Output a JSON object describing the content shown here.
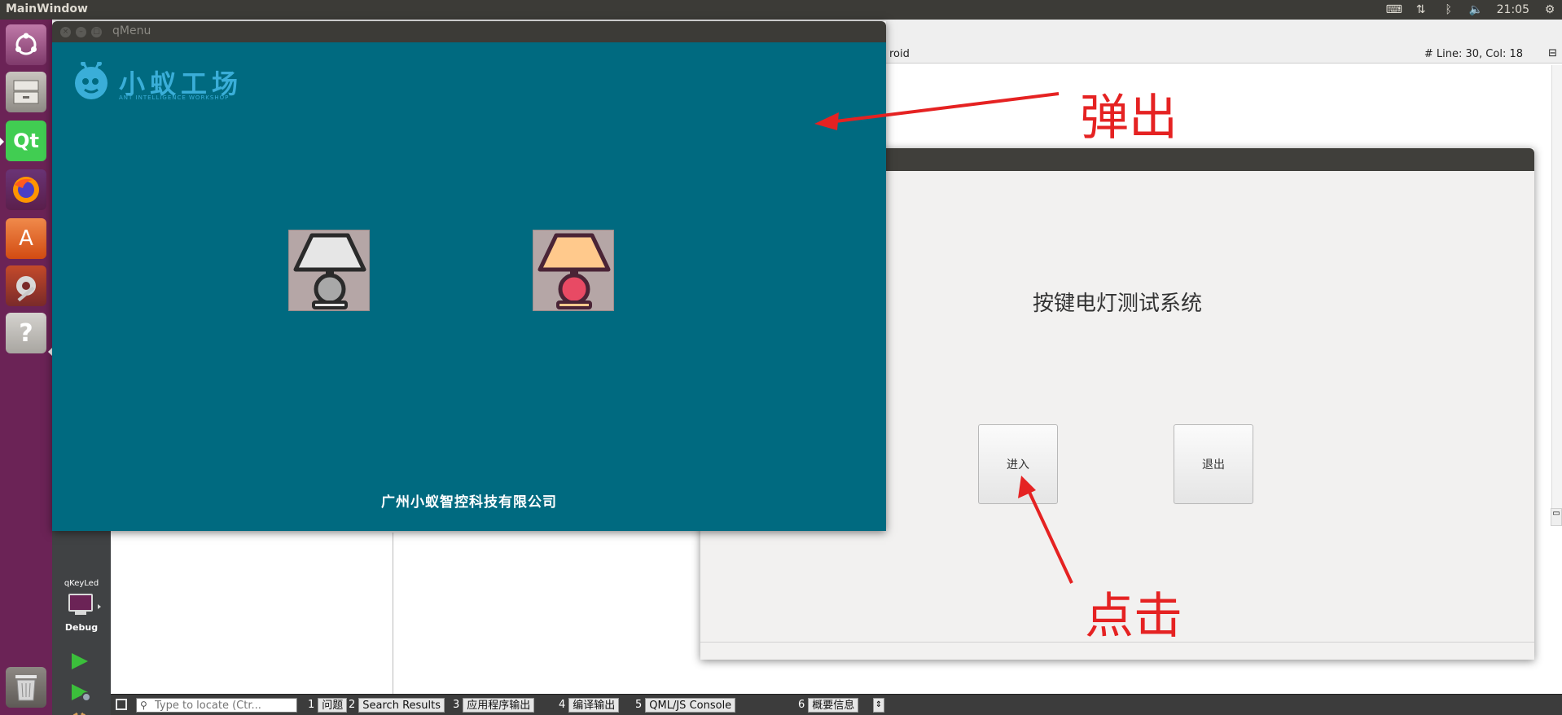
{
  "top_panel": {
    "title": "MainWindow",
    "tray": {
      "keyboard_icon": "keyboard-icon",
      "network_icon": "network-arrows-icon",
      "bluetooth_icon": "bluetooth-icon",
      "volume_icon": "volume-muted-icon",
      "time": "21:05",
      "settings_icon": "gear-icon"
    }
  },
  "launcher": {
    "items": [
      {
        "name": "ubuntu",
        "icon": "ubuntu-dash-icon"
      },
      {
        "name": "files",
        "icon": "file-cabinet-icon"
      },
      {
        "name": "qt-creator",
        "icon": "qt-icon",
        "label": "Qt"
      },
      {
        "name": "firefox",
        "icon": "firefox-icon"
      },
      {
        "name": "software",
        "icon": "software-store-icon",
        "label": "A"
      },
      {
        "name": "settings",
        "icon": "system-settings-icon"
      },
      {
        "name": "help",
        "icon": "help-icon",
        "label": "?"
      },
      {
        "name": "trash",
        "icon": "trash-icon"
      }
    ]
  },
  "qt_creator": {
    "editor_bar": {
      "left_text": "roid",
      "position": "# Line: 30, Col: 18"
    },
    "kit": {
      "project": "qKeyLed",
      "mode": "Debug"
    },
    "status_bar": {
      "locate_placeholder": "Type to locate (Ctr...",
      "tabs": [
        {
          "num": "1",
          "label": "问题"
        },
        {
          "num": "2",
          "label": "Search Results"
        },
        {
          "num": "3",
          "label": "应用程序输出"
        },
        {
          "num": "4",
          "label": "编译输出"
        },
        {
          "num": "5",
          "label": "QML/JS Console"
        },
        {
          "num": "6",
          "label": "概要信息"
        }
      ]
    }
  },
  "qmenu_window": {
    "title": "qMenu",
    "logo": {
      "name": "小蚁工场",
      "subtitle": "ANT INTELLIGENCE WORKSHOP"
    },
    "lamps": [
      {
        "state": "off",
        "shade_color": "#e6e6e6",
        "base_color": "#a8a8a8"
      },
      {
        "state": "on",
        "shade_color": "#ffc98c",
        "base_color": "#e84a64"
      }
    ],
    "company": "广州小蚁智控科技有限公司",
    "background_color": "#006a80"
  },
  "keyled_window": {
    "title": "按键电灯测试系统",
    "enter_button": "进入",
    "exit_button": "退出"
  },
  "annotations": {
    "popup": "弹出",
    "click": "点击",
    "color": "#e52222"
  }
}
